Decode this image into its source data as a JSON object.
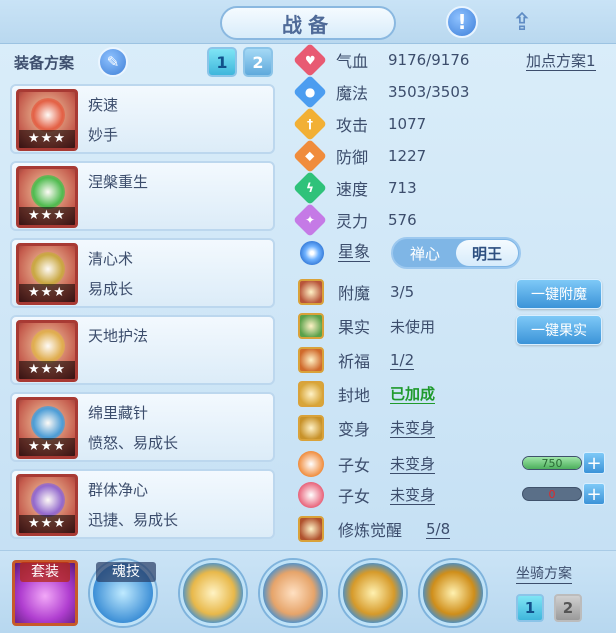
{
  "header": {
    "title": "战备"
  },
  "plan": {
    "label": "装备方案",
    "tabs": [
      "1",
      "2"
    ],
    "active_tab": "1"
  },
  "equipment": [
    {
      "name": "疾速",
      "sub": "妙手",
      "stars": "★★★",
      "color": "#e45a3f"
    },
    {
      "name": "涅槃重生",
      "sub": "",
      "stars": "★★★",
      "color": "#3fbf4a"
    },
    {
      "name": "清心术",
      "sub": "易成长",
      "stars": "★★★",
      "color": "#c7a93b"
    },
    {
      "name": "天地护法",
      "sub": "",
      "stars": "★★★",
      "color": "#e0b04a"
    },
    {
      "name": "绵里藏针",
      "sub": "愤怒、易成长",
      "stars": "★★★",
      "color": "#3b9de0"
    },
    {
      "name": "群体净心",
      "sub": "迅捷、易成长",
      "stars": "★★★",
      "color": "#8a63d6"
    }
  ],
  "stats": {
    "add_plan": "加点方案1",
    "items": [
      {
        "label": "气血",
        "value": "9176/9176",
        "icon": "heart-icon",
        "color": "#e85a72"
      },
      {
        "label": "魔法",
        "value": "3503/3503",
        "icon": "mana-icon",
        "color": "#4c9df0"
      },
      {
        "label": "攻击",
        "value": "1077",
        "icon": "sword-icon",
        "color": "#f2b035"
      },
      {
        "label": "防御",
        "value": "1227",
        "icon": "shield-icon",
        "color": "#f08c3c"
      },
      {
        "label": "速度",
        "value": "713",
        "icon": "lightning-icon",
        "color": "#2fc27a"
      },
      {
        "label": "灵力",
        "value": "576",
        "icon": "spirit-icon",
        "color": "#c57ae6"
      }
    ]
  },
  "star_sign": {
    "label": "星象",
    "options": [
      "禅心",
      "明王"
    ],
    "selected": "明王"
  },
  "enhance": [
    {
      "label": "附魔",
      "value": "3/5",
      "style": "plain",
      "icon_color": "#b8553a"
    },
    {
      "label": "果实",
      "value": "未使用",
      "style": "plain",
      "icon_color": "#5aa14a"
    },
    {
      "label": "祈福",
      "value": "1/2",
      "style": "underline",
      "icon_color": "#d06a2c"
    },
    {
      "label": "封地",
      "value": "已加成",
      "style": "green",
      "icon_color": "#d8a63a"
    },
    {
      "label": "变身",
      "value": "未变身",
      "style": "underline",
      "icon_color": "#c8922a"
    },
    {
      "label": "子女",
      "value": "未变身",
      "style": "underline",
      "icon_color": "#f08c3c"
    },
    {
      "label": "子女",
      "value": "未变身",
      "style": "underline",
      "icon_color": "#e8637a"
    },
    {
      "label": "修炼觉醒",
      "value": "5/8",
      "style": "underline",
      "icon_color": "#b0522e"
    }
  ],
  "buttons": {
    "one_click_enchant": "一键附魔",
    "one_click_fruit": "一键果实"
  },
  "children_bars": [
    {
      "value": "750",
      "fraction": 1.0,
      "color": "#2a6b35"
    },
    {
      "value": "0",
      "fraction": 0.0,
      "color": "#e02a2a"
    }
  ],
  "bottom": {
    "suit_label": "套装",
    "soul_label": "魂技",
    "mount_label": "坐骑方案",
    "mount_tabs": [
      "1",
      "2"
    ]
  }
}
